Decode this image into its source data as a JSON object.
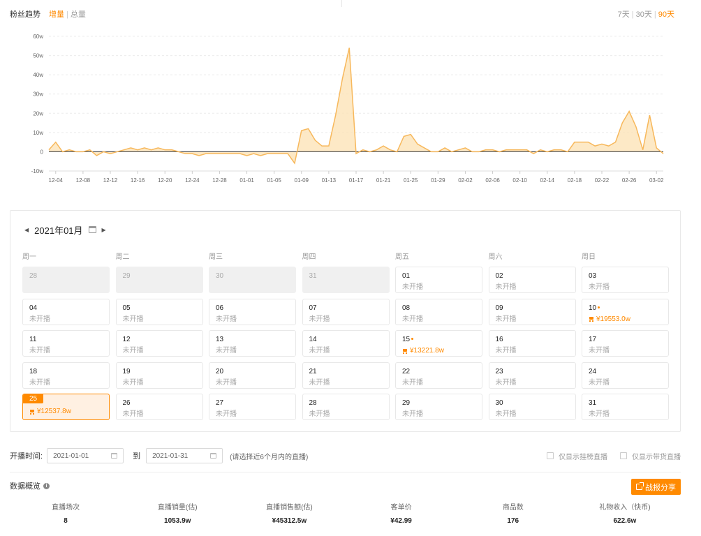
{
  "header": {
    "title": "粉丝趋势",
    "mode_active": "增量",
    "mode_separator": "|",
    "mode_other": "总量",
    "range_7": "7天",
    "range_30": "30天",
    "range_90": "90天",
    "range_separator": "|"
  },
  "colors": {
    "accent": "#ff8a00",
    "line": "#f7b85c",
    "fill": "#fde3b8"
  },
  "chart_data": {
    "type": "area",
    "x": [
      "12-03",
      "12-04",
      "12-05",
      "12-06",
      "12-07",
      "12-08",
      "12-09",
      "12-10",
      "12-11",
      "12-12",
      "12-13",
      "12-14",
      "12-15",
      "12-16",
      "12-17",
      "12-18",
      "12-19",
      "12-20",
      "12-21",
      "12-22",
      "12-23",
      "12-24",
      "12-25",
      "12-26",
      "12-27",
      "12-28",
      "12-29",
      "12-30",
      "12-31",
      "01-01",
      "01-02",
      "01-03",
      "01-04",
      "01-05",
      "01-06",
      "01-07",
      "01-08",
      "01-09",
      "01-10",
      "01-11",
      "01-12",
      "01-13",
      "01-14",
      "01-15",
      "01-16",
      "01-17",
      "01-18",
      "01-19",
      "01-20",
      "01-21",
      "01-22",
      "01-23",
      "01-24",
      "01-25",
      "01-26",
      "01-27",
      "01-28",
      "01-29",
      "01-30",
      "01-31",
      "02-01",
      "02-02",
      "02-03",
      "02-04",
      "02-05",
      "02-06",
      "02-07",
      "02-08",
      "02-09",
      "02-10",
      "02-11",
      "02-12",
      "02-13",
      "02-14",
      "02-15",
      "02-16",
      "02-17",
      "02-18",
      "02-19",
      "02-20",
      "02-21",
      "02-22",
      "02-23",
      "02-24",
      "02-25",
      "02-26",
      "02-27",
      "02-28",
      "03-01",
      "03-02",
      "03-03"
    ],
    "values": [
      1,
      5,
      0,
      1,
      0,
      0,
      1,
      -2,
      0,
      -1,
      0,
      1,
      2,
      1,
      2,
      1,
      2,
      1,
      1,
      0,
      -1,
      -1,
      -2,
      -1,
      -1,
      -1,
      -1,
      -1,
      -1,
      -2,
      -1,
      -2,
      -1,
      -1,
      -1,
      -1,
      -6,
      11,
      12,
      6,
      3,
      3,
      19,
      38,
      54,
      -1,
      1,
      0,
      1,
      3,
      1,
      0,
      8,
      9,
      4,
      2,
      0,
      0,
      2,
      0,
      1,
      2,
      0,
      0,
      1,
      1,
      0,
      1,
      1,
      1,
      1,
      -1,
      1,
      0,
      1,
      1,
      0,
      5,
      5,
      5,
      3,
      4,
      3,
      5,
      15,
      21,
      13,
      1,
      19,
      2,
      -1
    ],
    "x_ticks": [
      "12-04",
      "12-08",
      "12-12",
      "12-16",
      "12-20",
      "12-24",
      "12-28",
      "01-01",
      "01-05",
      "01-09",
      "01-13",
      "01-17",
      "01-21",
      "01-25",
      "01-29",
      "02-02",
      "02-06",
      "02-10",
      "02-14",
      "02-18",
      "02-22",
      "02-26",
      "03-02"
    ],
    "y_ticks": [
      "-10w",
      "0",
      "10w",
      "20w",
      "30w",
      "40w",
      "50w",
      "60w"
    ],
    "ylim": [
      -10,
      60
    ],
    "unit": "w",
    "grid": true
  },
  "calendar": {
    "month_label": "2021年01月",
    "weekdays": [
      "周一",
      "周二",
      "周三",
      "周四",
      "周五",
      "周六",
      "周日"
    ],
    "not_live": "未开播",
    "days": [
      {
        "day": "28",
        "faded": true
      },
      {
        "day": "29",
        "faded": true
      },
      {
        "day": "30",
        "faded": true
      },
      {
        "day": "31",
        "faded": true
      },
      {
        "day": "01"
      },
      {
        "day": "02"
      },
      {
        "day": "03"
      },
      {
        "day": "04"
      },
      {
        "day": "05"
      },
      {
        "day": "06"
      },
      {
        "day": "07"
      },
      {
        "day": "08"
      },
      {
        "day": "09"
      },
      {
        "day": "10",
        "sales": "¥19553.0w"
      },
      {
        "day": "11"
      },
      {
        "day": "12"
      },
      {
        "day": "13"
      },
      {
        "day": "14"
      },
      {
        "day": "15",
        "sales": "¥13221.8w"
      },
      {
        "day": "16"
      },
      {
        "day": "17"
      },
      {
        "day": "18"
      },
      {
        "day": "19"
      },
      {
        "day": "20"
      },
      {
        "day": "21"
      },
      {
        "day": "22"
      },
      {
        "day": "23"
      },
      {
        "day": "24"
      },
      {
        "day": "25",
        "sales": "¥12537.8w",
        "selected": true
      },
      {
        "day": "26"
      },
      {
        "day": "27"
      },
      {
        "day": "28"
      },
      {
        "day": "29"
      },
      {
        "day": "30"
      },
      {
        "day": "31"
      }
    ]
  },
  "filter": {
    "label": "开播时间:",
    "start": "2021-01-01",
    "to": "到",
    "end": "2021-01-31",
    "hint": "(请选择近6个月内的直播)",
    "check_charts": "仅显示挂榜直播",
    "check_goods": "仅显示带货直播"
  },
  "overview": {
    "title": "数据概览",
    "share_label": "战报分享",
    "stats": [
      {
        "label": "直播场次",
        "value": "8"
      },
      {
        "label": "直播销量(估)",
        "value": "1053.9w"
      },
      {
        "label": "直播销售额(估)",
        "value": "¥45312.5w"
      },
      {
        "label": "客单价",
        "value": "¥42.99"
      },
      {
        "label": "商品数",
        "value": "176"
      },
      {
        "label": "礼物收入（快币)",
        "value": "622.6w"
      }
    ]
  }
}
